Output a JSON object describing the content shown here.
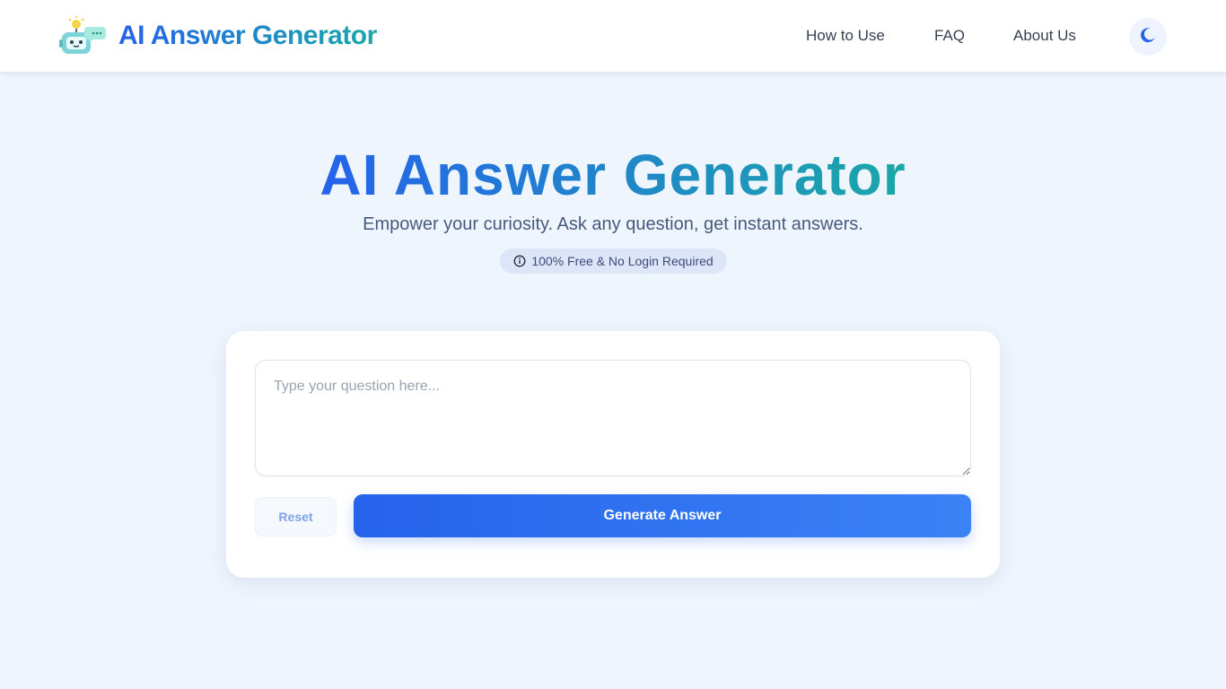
{
  "header": {
    "brand": "AI Answer Generator",
    "logo_icon": "robot-icon",
    "nav": [
      {
        "label": "How to Use"
      },
      {
        "label": "FAQ"
      },
      {
        "label": "About Us"
      }
    ],
    "theme_toggle_icon": "moon-icon"
  },
  "hero": {
    "title": "AI Answer Generator",
    "subtitle": "Empower your curiosity. Ask any question, get instant answers.",
    "badge": {
      "icon": "info-icon",
      "text": "100% Free & No Login Required"
    }
  },
  "form": {
    "question_value": "",
    "question_placeholder": "Type your question here...",
    "reset_label": "Reset",
    "generate_label": "Generate Answer"
  },
  "colors": {
    "brand_blue": "#2563eb",
    "brand_teal": "#1ba8a8",
    "page_bg": "#eff5fd",
    "badge_bg": "#dde5f8"
  }
}
